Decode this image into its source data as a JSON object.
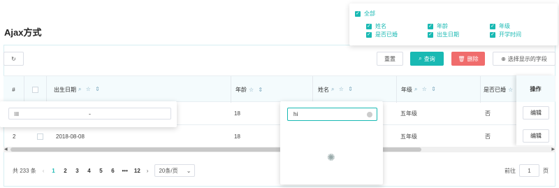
{
  "page": {
    "title": "Ajax方式"
  },
  "toolbar": {
    "reset": "重置",
    "query": "查询",
    "delete": "删除",
    "choose_fields": "选择显示的字段"
  },
  "columns": [
    "#",
    "出生日期",
    "年龄",
    "姓名",
    "年级",
    "是否已婚",
    "操作"
  ],
  "rows": [
    {
      "index": "",
      "birthday": "",
      "age": "18",
      "name": "",
      "grade": "五年级",
      "married": "否",
      "action": "编辑"
    },
    {
      "index": "2",
      "birthday": "2018-08-08",
      "age": "18",
      "name": "",
      "grade": "五年级",
      "married": "否",
      "action": "编辑"
    }
  ],
  "pagination": {
    "total": "共 233 条",
    "pages": [
      "1",
      "2",
      "3",
      "4",
      "5",
      "6",
      "•••",
      "12"
    ],
    "page_size": "20条/页",
    "goto_label": "前往",
    "current_page": "1",
    "page_suffix": "页"
  },
  "date_filter": {
    "separator": "-"
  },
  "name_filter": {
    "value": "hi"
  },
  "field_chooser": {
    "all": "全部",
    "fields": [
      "姓名",
      "年龄",
      "年级",
      "是否已婚",
      "出生日期",
      "开学时间"
    ]
  },
  "colors": {
    "accent": "#19b9b3",
    "danger": "#f06c6c"
  }
}
